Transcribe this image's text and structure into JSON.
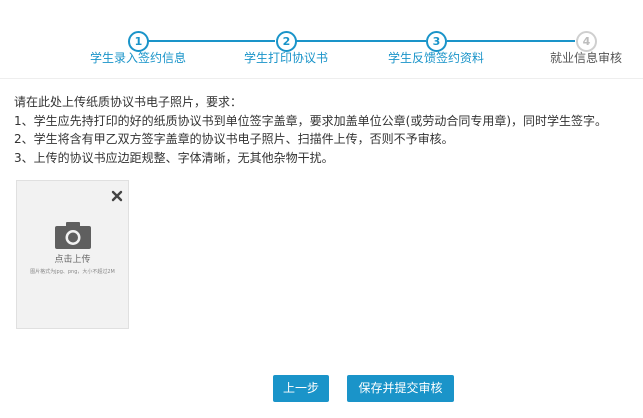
{
  "steps": [
    {
      "number": "1",
      "label": "学生录入签约信息",
      "status": "done"
    },
    {
      "number": "2",
      "label": "学生打印协议书",
      "status": "done"
    },
    {
      "number": "3",
      "label": "学生反馈签约资料",
      "status": "done"
    },
    {
      "number": "4",
      "label": "就业信息审核",
      "status": "pending"
    }
  ],
  "instructions": {
    "intro": "请在此处上传纸质协议书电子照片，要求：",
    "line1": "1、学生应先持打印的好的纸质协议书到单位签字盖章，要求加盖单位公章(或劳动合同专用章)，同时学生签字。",
    "line2": "2、学生将含有甲乙双方签字盖章的协议书电子照片、扫描件上传，否则不予审核。",
    "line3": "3、上传的协议书应边距规整、字体清晰，无其他杂物干扰。"
  },
  "upload": {
    "label": "点击上传",
    "hint": "图片格式为jpg、png，大小不超过2M",
    "close_icon": "close-icon",
    "camera_icon": "camera-icon"
  },
  "buttons": {
    "prev": "上一步",
    "submit": "保存并提交审核"
  },
  "colors": {
    "accent": "#1a94c9",
    "pending": "#cfcfcf"
  }
}
